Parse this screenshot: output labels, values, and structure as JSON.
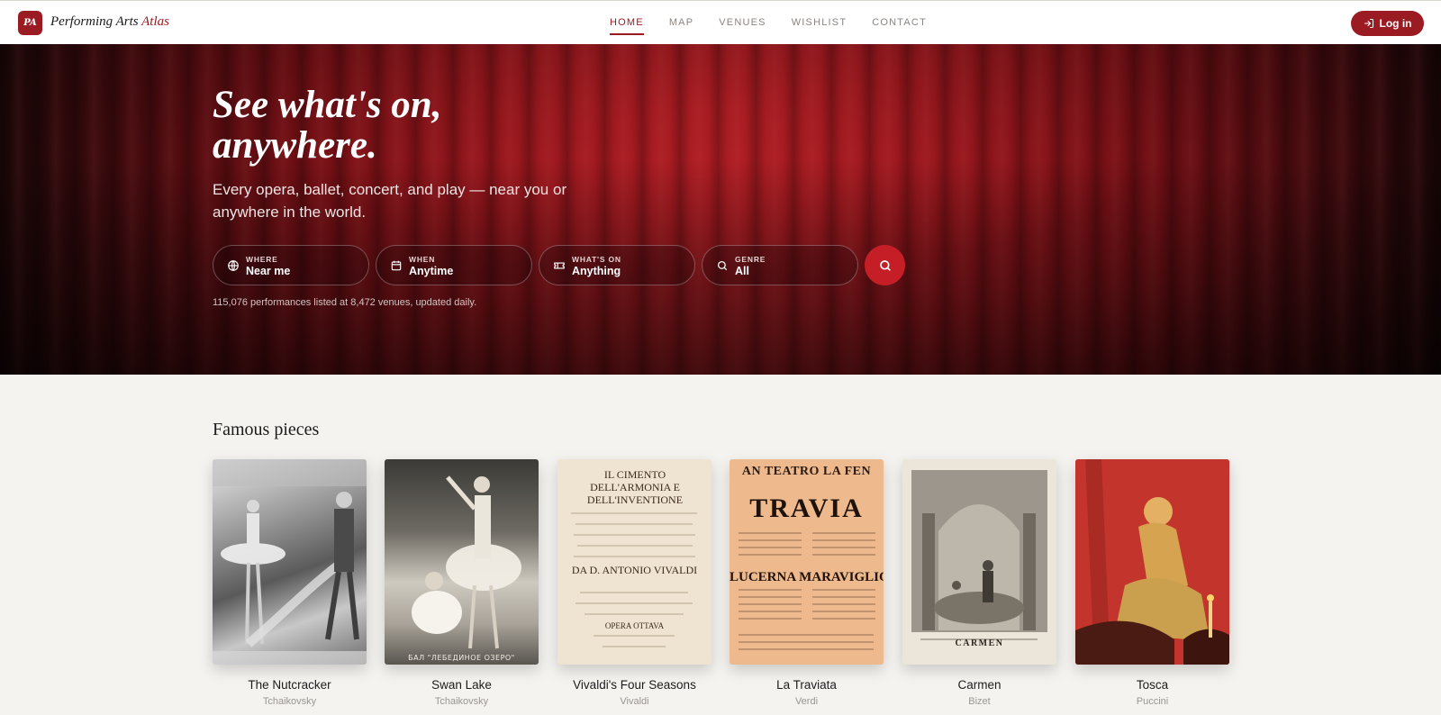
{
  "header": {
    "logo_initials": "PA",
    "brand_main": "Performing Arts",
    "brand_accent": "Atlas",
    "nav": [
      {
        "label": "HOME",
        "active": true
      },
      {
        "label": "MAP",
        "active": false
      },
      {
        "label": "VENUES",
        "active": false
      },
      {
        "label": "WISHLIST",
        "active": false
      },
      {
        "label": "CONTACT",
        "active": false
      }
    ],
    "login_label": "Log in"
  },
  "hero": {
    "title_line1": "See what's on,",
    "title_line2": "anywhere.",
    "subtitle": "Every opera, ballet, concert, and play — near you or anywhere in the world.",
    "search": {
      "where": {
        "label": "WHERE",
        "value": "Near me",
        "icon": "globe-icon"
      },
      "when": {
        "label": "WHEN",
        "value": "Anytime",
        "icon": "calendar-icon"
      },
      "whats_on": {
        "label": "WHAT'S ON",
        "value": "Anything",
        "icon": "ticket-icon"
      },
      "genre": {
        "label": "GENRE",
        "value": "All",
        "icon": "search-icon"
      }
    },
    "stats": "115,076 performances listed at 8,472 venues, updated daily."
  },
  "famous": {
    "title": "Famous pieces",
    "pieces": [
      {
        "title": "The Nutcracker",
        "composer": "Tchaikovsky"
      },
      {
        "title": "Swan Lake",
        "composer": "Tchaikovsky",
        "poster_caption": "БАЛ \"ЛЕБЕДИНОЕ ОЗЕРО\""
      },
      {
        "title": "Vivaldi's Four Seasons",
        "composer": "Vivaldi",
        "poster_caption": "IL CIMENTO DELL'ARMONIA E DELL'INVENTIONE",
        "poster_caption2": "DA D. ANTONIO VIVALDI",
        "poster_caption3": "OPERA OTTAVA"
      },
      {
        "title": "La Traviata",
        "composer": "Verdi",
        "poster_caption": "AN TEATRO LA FEN",
        "poster_caption2": "TRAVIA",
        "poster_caption3": "LUCERNA MARAVIGLIO"
      },
      {
        "title": "Carmen",
        "composer": "Bizet",
        "poster_caption": "CARMEN"
      },
      {
        "title": "Tosca",
        "composer": "Puccini"
      }
    ]
  },
  "colors": {
    "brand": "#9b1b22",
    "search_button": "#c61e26",
    "background": "#f5f3ef"
  }
}
